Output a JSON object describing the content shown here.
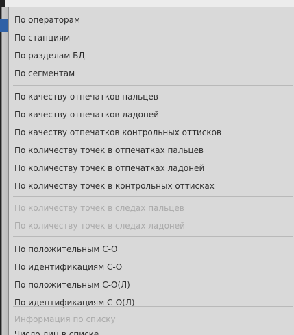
{
  "menu": {
    "items": [
      {
        "label": "По операторам",
        "enabled": true
      },
      {
        "label": "По станциям",
        "enabled": true
      },
      {
        "label": "По разделам БД",
        "enabled": true
      },
      {
        "label": "По сегментам",
        "enabled": true
      },
      {
        "label": "По качеству отпечатков пальцев",
        "enabled": true
      },
      {
        "label": "По качеству отпечатков ладоней",
        "enabled": true
      },
      {
        "label": "По качеству отпечатков контрольных оттисков",
        "enabled": true
      },
      {
        "label": "По количеству точек в отпечатках пальцев",
        "enabled": true
      },
      {
        "label": "По количеству точек в отпечатках ладоней",
        "enabled": true
      },
      {
        "label": "По количеству точек в контрольных оттисках",
        "enabled": true
      },
      {
        "label": "По количеству точек в следах пальцев",
        "enabled": false
      },
      {
        "label": "По количеству точек в следах ладоней",
        "enabled": false
      },
      {
        "label": "По положительным С-О",
        "enabled": true
      },
      {
        "label": "По идентификациям С-О",
        "enabled": true
      },
      {
        "label": "По положительным С-О(Л)",
        "enabled": true
      },
      {
        "label": "По идентификациям С-О(Л)",
        "enabled": true
      },
      {
        "label": "Информация по списку",
        "enabled": false
      },
      {
        "label": "Число лиц в списке",
        "enabled": true
      }
    ]
  }
}
